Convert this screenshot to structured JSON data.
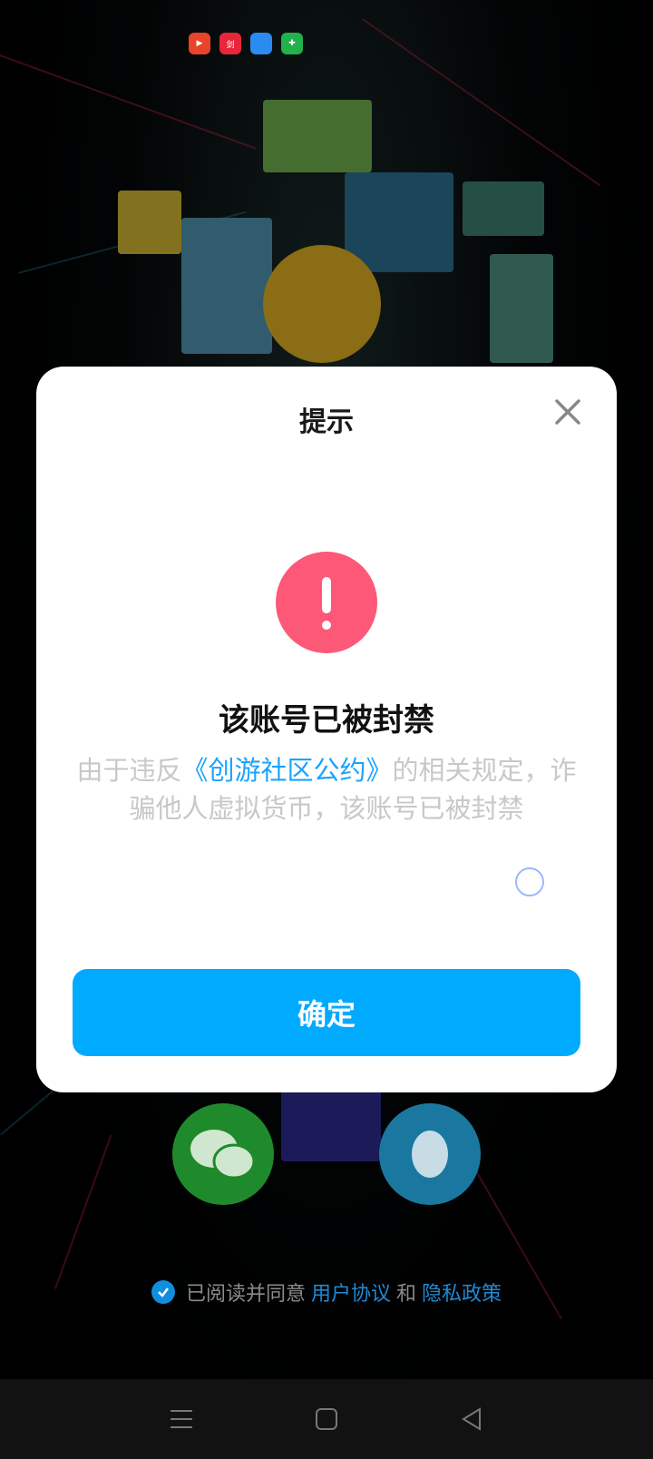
{
  "status_bar": {
    "apps": [
      {
        "icon": "video-app-icon",
        "color": "#e8442a",
        "text": "▶"
      },
      {
        "icon": "news-app-icon",
        "color": "#e8253a",
        "text": "剑"
      },
      {
        "icon": "browser-app-icon",
        "color": "#2a8cf0",
        "text": ""
      },
      {
        "icon": "security-app-icon",
        "color": "#22b24c",
        "text": "✚"
      }
    ]
  },
  "dialog": {
    "title": "提示",
    "heading": "该账号已被封禁",
    "desc_before": "由于违反",
    "desc_link": "《创游社区公约》",
    "desc_after": "的相关规定，诈骗他人虚拟货币，该账号已被封禁",
    "confirm_label": "确定"
  },
  "agreement": {
    "prefix": "已阅读并同意",
    "user_agreement": "用户协议",
    "and": "和",
    "privacy_policy": "隐私政策"
  },
  "colors": {
    "accent": "#00aaff",
    "warning": "#fd5877",
    "link": "#1aa3ff"
  }
}
